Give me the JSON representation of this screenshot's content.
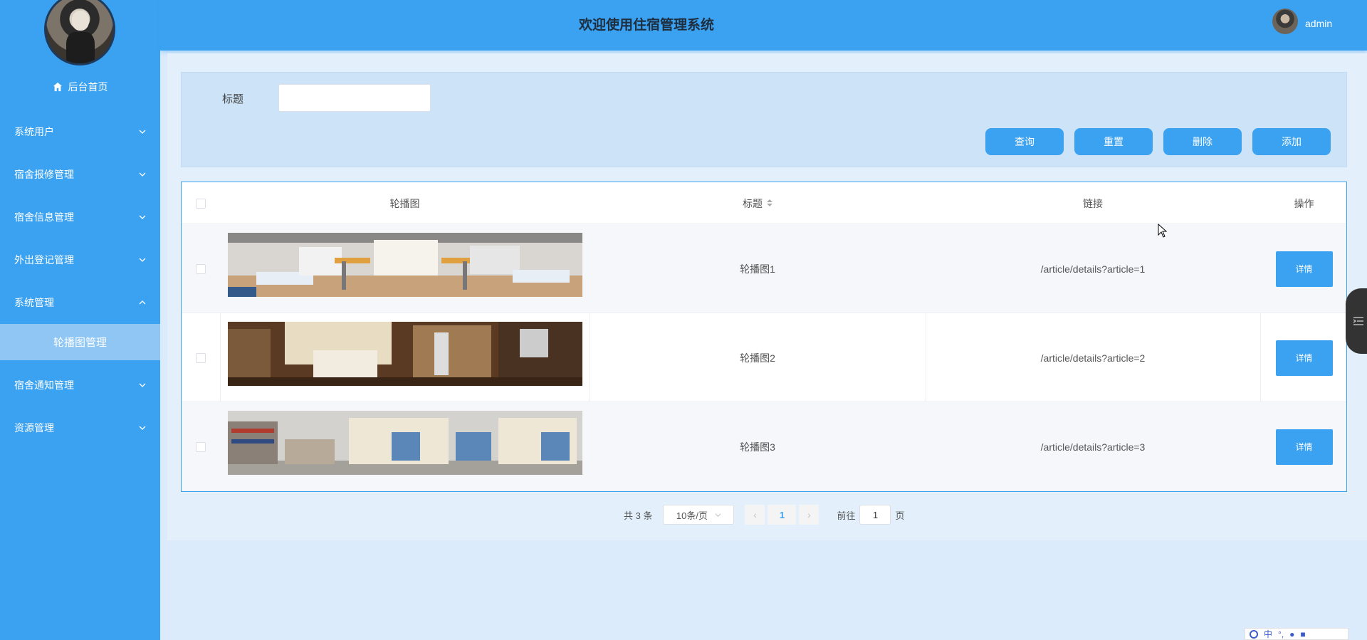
{
  "header": {
    "title": "欢迎使用住宿管理系统",
    "username": "admin"
  },
  "sidebar": {
    "home_label": "后台首页",
    "items": [
      {
        "label": "系统用户"
      },
      {
        "label": "宿舍报修管理"
      },
      {
        "label": "宿舍信息管理"
      },
      {
        "label": "外出登记管理"
      },
      {
        "label": "系统管理",
        "expanded": true
      },
      {
        "label": "宿舍通知管理"
      },
      {
        "label": "资源管理"
      }
    ],
    "active_sub": "轮播图管理"
  },
  "search": {
    "label": "标题",
    "value": "",
    "placeholder": ""
  },
  "buttons": {
    "query": "查询",
    "reset": "重置",
    "delete": "删除",
    "add": "添加"
  },
  "table": {
    "headers": {
      "image": "轮播图",
      "title": "标题",
      "link": "链接",
      "action": "操作"
    },
    "rows": [
      {
        "title": "轮播图1",
        "link": "/article/details?article=1",
        "action": "详情"
      },
      {
        "title": "轮播图2",
        "link": "/article/details?article=2",
        "action": "详情"
      },
      {
        "title": "轮播图3",
        "link": "/article/details?article=3",
        "action": "详情"
      }
    ]
  },
  "pagination": {
    "total": "共 3 条",
    "page_size": "10条/页",
    "current_page": "1",
    "goto_label": "前往",
    "goto_value": "1",
    "page_suffix": "页",
    "prev": "‹",
    "next": "›"
  },
  "ime": {
    "mode": "中"
  },
  "colors": {
    "primary": "#3aa2f1",
    "sidebar": "#3aa2f1",
    "submenu_active": "#8fc6f3"
  }
}
